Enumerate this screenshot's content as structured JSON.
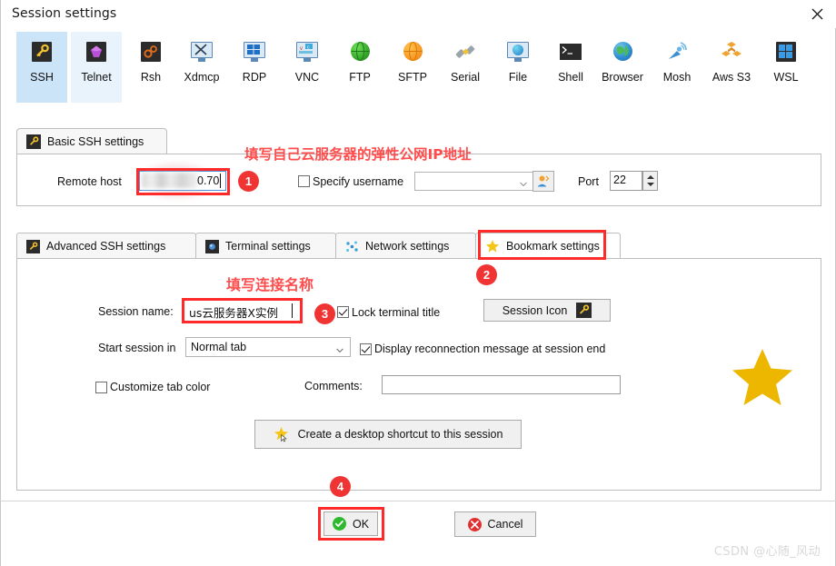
{
  "window": {
    "title": "Session settings",
    "close_icon": "close-icon"
  },
  "protocols": [
    {
      "label": "SSH",
      "icon": "ssh-key-icon",
      "state": "selected"
    },
    {
      "label": "Telnet",
      "icon": "telnet-gem-icon",
      "state": "hover"
    },
    {
      "label": "Rsh",
      "icon": "rsh-gears-icon",
      "state": "normal"
    },
    {
      "label": "Xdmcp",
      "icon": "xdmcp-monitor-icon",
      "state": "normal"
    },
    {
      "label": "RDP",
      "icon": "rdp-monitor-icon",
      "state": "normal"
    },
    {
      "label": "VNC",
      "icon": "vnc-monitor-icon",
      "state": "normal"
    },
    {
      "label": "FTP",
      "icon": "ftp-globe-icon",
      "state": "normal"
    },
    {
      "label": "SFTP",
      "icon": "sftp-globe-icon",
      "state": "normal"
    },
    {
      "label": "Serial",
      "icon": "serial-plug-icon",
      "state": "normal"
    },
    {
      "label": "File",
      "icon": "file-monitor-icon",
      "state": "normal"
    },
    {
      "label": "Shell",
      "icon": "shell-prompt-icon",
      "state": "normal"
    },
    {
      "label": "Browser",
      "icon": "browser-globe-icon",
      "state": "normal"
    },
    {
      "label": "Mosh",
      "icon": "mosh-dish-icon",
      "state": "normal"
    },
    {
      "label": "Aws S3",
      "icon": "aws-s3-icon",
      "state": "normal"
    },
    {
      "label": "WSL",
      "icon": "wsl-windows-icon",
      "state": "normal"
    }
  ],
  "basic_ssh": {
    "tab_label": "Basic SSH settings",
    "tab_icon": "ssh-key-icon",
    "remote_host_label": "Remote host",
    "remote_host_value": "0.70",
    "remote_host_blurred": true,
    "specify_username_label": "Specify username",
    "specify_username_checked": false,
    "username_value": "",
    "username_picker_icon": "user-picker-icon",
    "port_label": "Port",
    "port_value": "22"
  },
  "inner_tabs": [
    {
      "label": "Advanced SSH settings",
      "icon": "ssh-key-icon",
      "active": false
    },
    {
      "label": "Terminal settings",
      "icon": "terminal-icon",
      "active": false
    },
    {
      "label": "Network settings",
      "icon": "network-dots-icon",
      "active": false
    },
    {
      "label": "Bookmark settings",
      "icon": "star-icon",
      "active": true
    }
  ],
  "bookmark": {
    "session_name_label": "Session name:",
    "session_name_value": "us云服务器X实例",
    "lock_terminal_title_label": "Lock terminal title",
    "lock_terminal_title_checked": true,
    "session_icon_button_label": "Session Icon",
    "session_icon_glyph": "ssh-key-icon",
    "start_session_in_label": "Start session in",
    "start_session_in_value": "Normal tab",
    "display_reconnection_label": "Display reconnection message at session end",
    "display_reconnection_checked": true,
    "customize_tab_color_label": "Customize tab color",
    "customize_tab_color_checked": false,
    "comments_label": "Comments:",
    "comments_value": "",
    "shortcut_button_label": "Create a desktop shortcut to this session",
    "shortcut_button_icon": "star-cursor-icon"
  },
  "footer": {
    "ok_label": "OK",
    "ok_icon": "check-circle-icon",
    "cancel_label": "Cancel",
    "cancel_icon": "x-circle-icon"
  },
  "annotations": {
    "note_ip": "填写自己云服务器的弹性公网IP地址",
    "note_name": "填写连接名称",
    "badges": [
      "1",
      "2",
      "3",
      "4"
    ],
    "decor_star": "big-star-icon"
  },
  "watermark": "CSDN @心随_风动",
  "colors": {
    "annotation_red": "#ff2a2a",
    "note_pink": "#ff4d4d",
    "badge_red": "#f03434",
    "tab_selected_blue": "#cce4f7",
    "tab_hover_blue": "#e9f3fc",
    "focus_border_blue": "#4a90d9",
    "star_yellow": "#edb700",
    "ok_green": "#2eb82e",
    "cancel_red": "#e03131"
  }
}
